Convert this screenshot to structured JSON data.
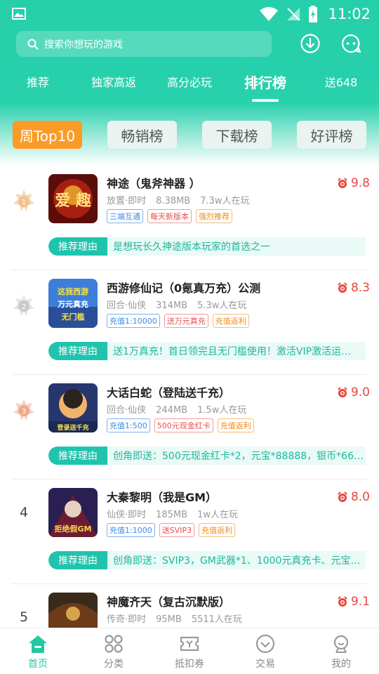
{
  "status_bar": {
    "time": "11:02"
  },
  "search": {
    "placeholder": "搜索你想玩的游戏"
  },
  "tabs": [
    {
      "label": "推荐"
    },
    {
      "label": "独家高返"
    },
    {
      "label": "高分必玩"
    },
    {
      "label": "排行榜",
      "active": true
    },
    {
      "label": "送648"
    }
  ],
  "chips": [
    {
      "label": "周Top10",
      "active": true
    },
    {
      "label": "畅销榜"
    },
    {
      "label": "下载榜"
    },
    {
      "label": "好评榜"
    }
  ],
  "reason_label": "推荐理由",
  "games": [
    {
      "rank": "1",
      "title": "神途（鬼斧神器 ）",
      "genre": "放置·即时",
      "size": "8.38MB",
      "players": "7.3w人在玩",
      "tags": [
        {
          "text": "三端互通",
          "color": "blue"
        },
        {
          "text": "每天新版本",
          "color": "red"
        },
        {
          "text": "强烈推荐",
          "color": "orange"
        }
      ],
      "score": "9.8",
      "reason": "是想玩长久神途版本玩家的首选之一",
      "thumb_text": "爱 趣"
    },
    {
      "rank": "2",
      "title": "西游修仙记（0氪真万充）公测",
      "genre": "回合·仙侠",
      "size": "314MB",
      "players": "5.3w人在玩",
      "tags": [
        {
          "text": "充值1:10000",
          "color": "blue"
        },
        {
          "text": "送万元真充",
          "color": "red"
        },
        {
          "text": "充值返利",
          "color": "orange"
        }
      ],
      "score": "8.3",
      "reason": "送1万真充！首日领完且无门槛使用！激活VIP激活运…",
      "thumb_text": "这我西游 万元真充 无门槛"
    },
    {
      "rank": "3",
      "title": "大话白蛇（登陆送千充）",
      "genre": "回合·仙侠",
      "size": "244MB",
      "players": "1.5w人在玩",
      "tags": [
        {
          "text": "充值1:500",
          "color": "blue"
        },
        {
          "text": "500元现金红卡",
          "color": "red"
        },
        {
          "text": "充值返利",
          "color": "orange"
        }
      ],
      "score": "9.0",
      "reason": "创角即送：500元现金红卡*2，元宝*88888，银币*66…",
      "thumb_text": "登录送千充"
    },
    {
      "rank": "4",
      "title": "大秦黎明（我是GM）",
      "genre": "仙侠·即时",
      "size": "185MB",
      "players": "1w人在玩",
      "tags": [
        {
          "text": "充值1:1000",
          "color": "blue"
        },
        {
          "text": "送SVIP3",
          "color": "red"
        },
        {
          "text": "充值返利",
          "color": "orange"
        }
      ],
      "score": "8.0",
      "reason": "创角即送：SVIP3，GM武器*1、1000元真充卡、元宝…",
      "thumb_text": "拒绝假GM"
    },
    {
      "rank": "5",
      "title": "神魔齐天（复古沉默版）",
      "genre": "传奇·即时",
      "size": "95MB",
      "players": "5511人在玩",
      "tags": [],
      "score": "9.1",
      "reason": "",
      "thumb_text": ""
    }
  ],
  "bottom_nav": [
    {
      "label": "首页",
      "active": true
    },
    {
      "label": "分类"
    },
    {
      "label": "抵扣券"
    },
    {
      "label": "交易"
    },
    {
      "label": "我的"
    }
  ],
  "colors": {
    "brand": "#25cfa9",
    "chip_active": "#fb9b27",
    "score": "#e8473f",
    "reason_label": "#1fc4ad"
  }
}
